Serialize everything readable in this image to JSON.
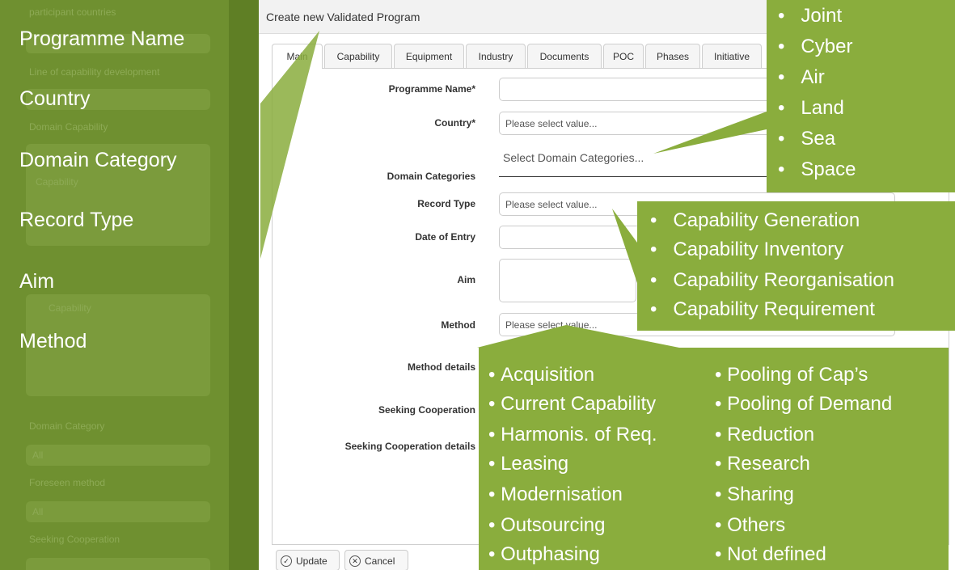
{
  "colors": {
    "overlay_green": "#8aad3d",
    "sidebar_green": "#6f9030"
  },
  "sidebar": {
    "ghost_items": [
      "participant countries",
      "Line of capability development",
      "Domain Capability",
      "Capability",
      "Capability",
      "Domain Category",
      "All",
      "Foreseen method",
      "All",
      "Seeking Cooperation"
    ],
    "big_labels": [
      "Programme Name",
      "Country",
      "Domain Category",
      "Record Type",
      "Aim",
      "Method"
    ]
  },
  "dialog": {
    "title": "Create new Validated Program",
    "close_icon": "close-icon",
    "tabs": [
      "Main",
      "Capability",
      "Equipment",
      "Industry",
      "Documents",
      "POC",
      "Phases",
      "Initiative"
    ],
    "form": {
      "programme_name_label": "Programme Name*",
      "programme_name_value": "",
      "country_label": "Country*",
      "country_placeholder": "Please select value...",
      "domain_label": "Domain Categories",
      "domain_placeholder": "Select Domain Categories...",
      "record_type_label": "Record Type",
      "record_type_placeholder": "Please select value...",
      "date_label": "Date of Entry",
      "date_value": "",
      "aim_label": "Aim",
      "aim_value": "",
      "method_label": "Method",
      "method_placeholder": "Please select value...",
      "method_details_label": "Method details",
      "seeking_label": "Seeking Cooperation",
      "seeking_details_label": "Seeking Cooperation details"
    },
    "buttons": {
      "update": "Update",
      "cancel": "Cancel"
    }
  },
  "overlays": {
    "domains": [
      "Joint",
      "Cyber",
      "Air",
      "Land",
      "Sea",
      "Space"
    ],
    "record_types": [
      "Capability Generation",
      "Capability Inventory",
      "Capability Reorganisation",
      "Capability Requirement"
    ],
    "methods_left": [
      "Acquisition",
      "Current Capability",
      "Harmonis. of Req.",
      "Leasing",
      "Modernisation",
      "Outsourcing",
      "Outphasing"
    ],
    "methods_right": [
      "Pooling of Cap’s",
      "Pooling of Demand",
      "Reduction",
      "Research",
      "Sharing",
      "Others",
      "Not defined"
    ],
    "bullet": "•"
  }
}
